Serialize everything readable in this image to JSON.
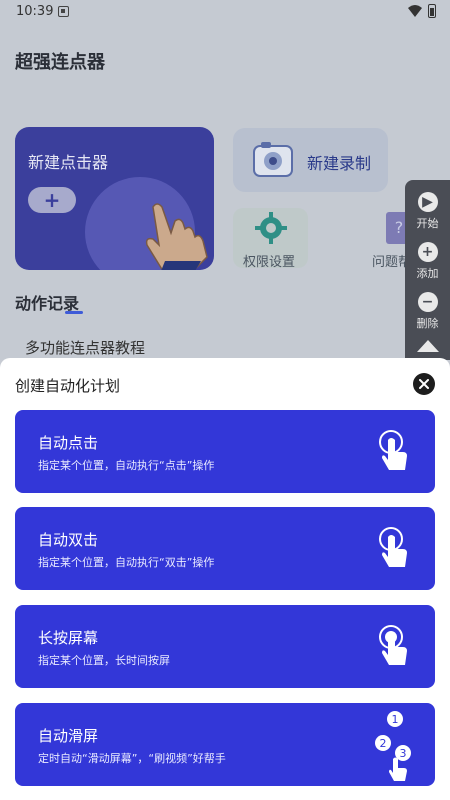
{
  "status_bar": {
    "time": "10:39"
  },
  "app": {
    "title": "超强连点器",
    "new_clicker": {
      "label": "新建点击器",
      "add_symbol": "+"
    },
    "new_record": {
      "label": "新建录制"
    },
    "permission": {
      "label": "权限设置"
    },
    "help": {
      "label": "问题帮"
    },
    "section_title": "动作记录",
    "tutorial_item": "多功能连点器教程"
  },
  "floating_toolbar": {
    "start": "开始",
    "add": "添加",
    "delete": "删除"
  },
  "sheet": {
    "title": "创建自动化计划",
    "options": [
      {
        "title": "自动点击",
        "desc": "指定某个位置，自动执行“点击”操作",
        "icon": "tap-icon"
      },
      {
        "title": "自动双击",
        "desc": "指定某个位置，自动执行“双击”操作",
        "icon": "double-tap-icon"
      },
      {
        "title": "长按屏幕",
        "desc": "指定某个位置，长时间按屏",
        "icon": "long-press-icon"
      },
      {
        "title": "自动滑屏",
        "desc": "定时自动“滑动屏幕”，“刷视频”好帮手",
        "icon": "swipe-icon",
        "steps": [
          "1",
          "2",
          "3"
        ]
      }
    ]
  },
  "colors": {
    "option_bg": "#3337d8",
    "card_bg": "#3b3f9c",
    "close_bg": "#1d1d1d"
  }
}
